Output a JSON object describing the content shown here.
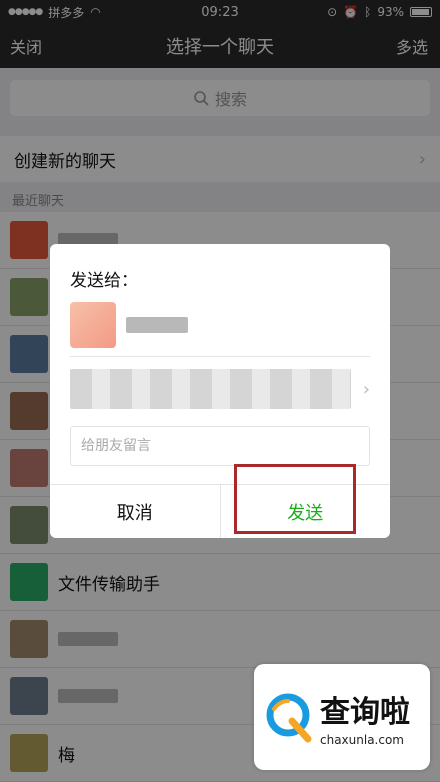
{
  "status": {
    "carrier": "拼多多",
    "time": "09:23",
    "battery": "93%",
    "battery_level": 0.93
  },
  "nav": {
    "left": "关闭",
    "title": "选择一个聊天",
    "right": "多选"
  },
  "search": {
    "placeholder": "搜索"
  },
  "list": {
    "create_label": "创建新的聊天",
    "section_label": "最近聊天",
    "rows": [
      {
        "name": "",
        "avatar_color": "#e85a3c"
      },
      {
        "name": "",
        "avatar_color": "#8aa16b"
      },
      {
        "name": "",
        "avatar_color": "#5b7fa0"
      },
      {
        "name": "",
        "avatar_color": "#9c6b54"
      },
      {
        "name": "",
        "avatar_color": "#c07a72"
      },
      {
        "name": "",
        "avatar_color": "#7c8a6e"
      },
      {
        "name": "文件传输助手",
        "avatar_color": "#2aae67"
      },
      {
        "name": "",
        "avatar_color": "#a38b6e"
      },
      {
        "name": "",
        "avatar_color": "#6e7f8f"
      },
      {
        "name": "梅",
        "avatar_color": "#b6a45a"
      }
    ]
  },
  "dialog": {
    "title": "发送给：",
    "message_placeholder": "给朋友留言",
    "cancel": "取消",
    "send": "发送"
  },
  "colors": {
    "dark_bar": "#2b2b2d",
    "send_green": "#1aad19",
    "highlight_red": "#a82a2a"
  }
}
